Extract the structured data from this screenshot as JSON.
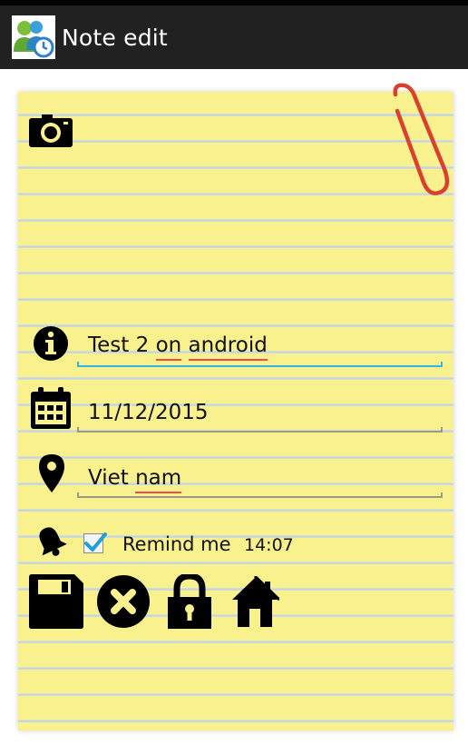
{
  "header": {
    "title": "Note edit",
    "app_icon": "people-clock-app-icon"
  },
  "note": {
    "camera_icon": "camera-icon",
    "title_value": {
      "plain": "Test 2 ",
      "word1": "on",
      "space": " ",
      "word2": "android"
    },
    "date_value": "11/12/2015",
    "location_value": {
      "plain": "Viet ",
      "word": "nam"
    },
    "remind": {
      "label": "Remind me",
      "time": "14:07",
      "checked": true
    }
  },
  "toolbar": {
    "save_icon": "floppy-disk-icon",
    "cancel_icon": "close-circle-icon",
    "lock_icon": "lock-icon",
    "home_icon": "home-icon"
  },
  "colors": {
    "paper": "#f9f18d",
    "focus_underline": "#33b5e5",
    "spell_underline": "#ef4a4a",
    "paperclip": "#d9402f",
    "action_bar": "#212121"
  }
}
